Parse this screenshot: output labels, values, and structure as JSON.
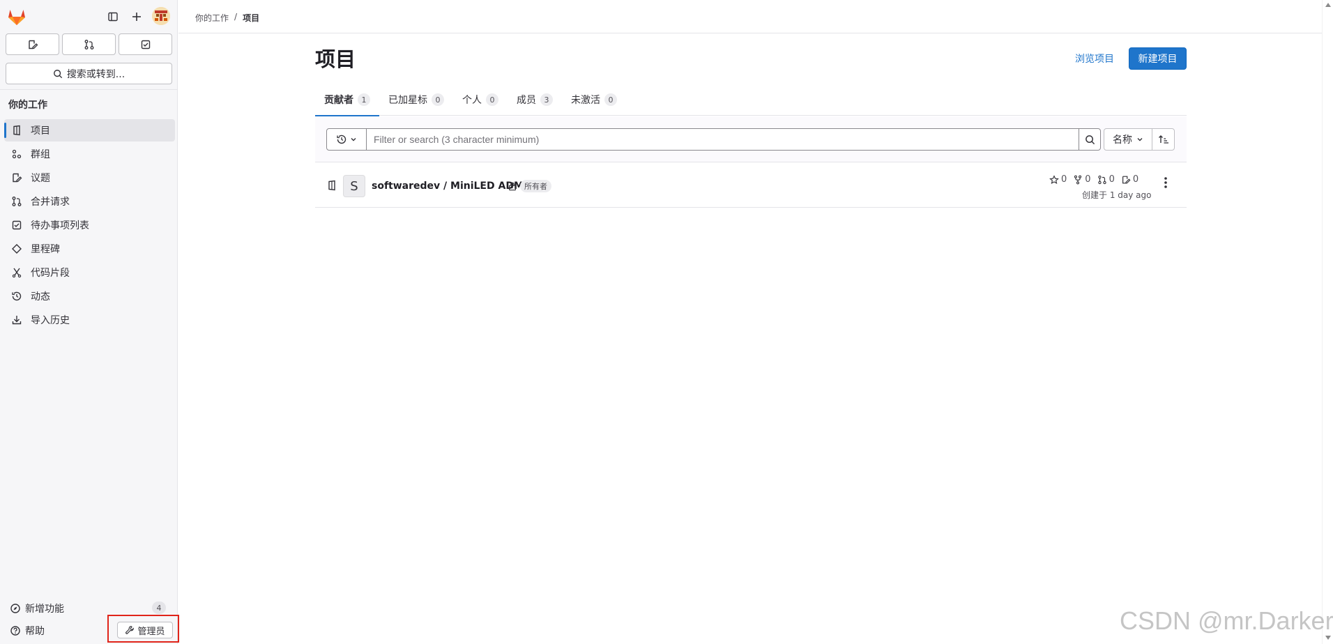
{
  "sidebar": {
    "search_label": "搜索或转到...",
    "section_title": "你的工作",
    "items": [
      {
        "label": "项目",
        "icon": "project-icon",
        "active": true
      },
      {
        "label": "群组",
        "icon": "group-icon"
      },
      {
        "label": "议题",
        "icon": "issues-icon"
      },
      {
        "label": "合并请求",
        "icon": "merge-request-icon"
      },
      {
        "label": "待办事项列表",
        "icon": "todo-icon"
      },
      {
        "label": "里程碑",
        "icon": "milestone-icon"
      },
      {
        "label": "代码片段",
        "icon": "snippet-icon"
      },
      {
        "label": "动态",
        "icon": "history-icon"
      },
      {
        "label": "导入历史",
        "icon": "import-icon"
      }
    ],
    "whats_new_label": "新增功能",
    "whats_new_count": "4",
    "help_label": "帮助",
    "admin_label": "管理员"
  },
  "breadcrumb": {
    "parent": "你的工作",
    "separator": "/",
    "current": "项目"
  },
  "page": {
    "title": "项目",
    "browse_link": "浏览项目",
    "new_button": "新建项目"
  },
  "tabs": [
    {
      "label": "贡献者",
      "count": "1",
      "active": true
    },
    {
      "label": "已加星标",
      "count": "0"
    },
    {
      "label": "个人",
      "count": "0"
    },
    {
      "label": "成员",
      "count": "3"
    },
    {
      "label": "未激活",
      "count": "0"
    }
  ],
  "filter": {
    "placeholder": "Filter or search (3 character minimum)",
    "sort_label": "名称"
  },
  "project": {
    "avatar_letter": "S",
    "name": "softwaredev / MiniLED ADM",
    "role": "所有者",
    "stars": "0",
    "forks": "0",
    "merge_requests": "0",
    "issues": "0",
    "created": "创建于 1 day ago"
  },
  "watermark": "CSDN @mr.Darker",
  "colors": {
    "accent": "#1f75cb",
    "highlight": "#e0241a"
  }
}
